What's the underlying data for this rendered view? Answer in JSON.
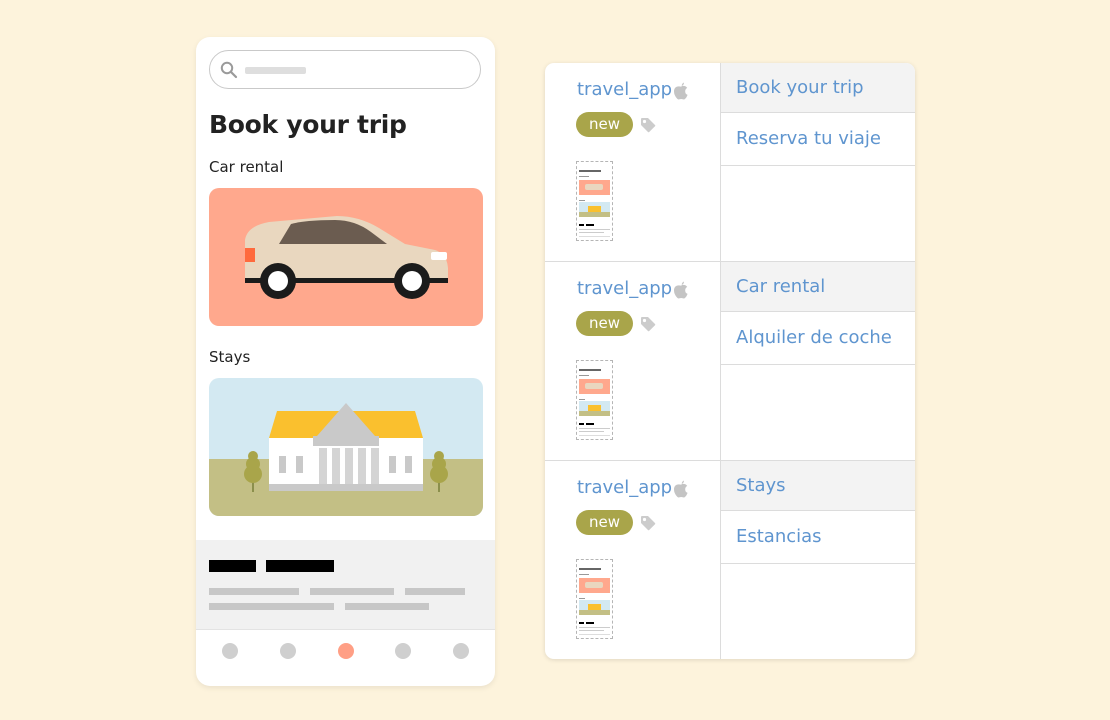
{
  "phone": {
    "title": "Book your trip",
    "sections": [
      "Car rental",
      "Stays"
    ],
    "nav": {
      "active_index": 2,
      "count": 5
    }
  },
  "table": {
    "rows": [
      {
        "key": "travel_app",
        "badge": "new",
        "source": "Book your trip",
        "translation": "Reserva tu viaje"
      },
      {
        "key": "travel_app",
        "badge": "new",
        "source": "Car rental",
        "translation": "Alquiler de coche"
      },
      {
        "key": "travel_app",
        "badge": "new",
        "source": "Stays",
        "translation": "Estancias"
      }
    ]
  },
  "colors": {
    "background": "#fdf3dc",
    "link_blue": "#5f95cf",
    "badge_olive": "#a9a54a",
    "car_card": "#ffa88d",
    "stay_card_sky": "#d3e9f2",
    "active_dot": "#ff9f85"
  },
  "icons": [
    "search-icon",
    "apple-icon",
    "tag-icon"
  ]
}
